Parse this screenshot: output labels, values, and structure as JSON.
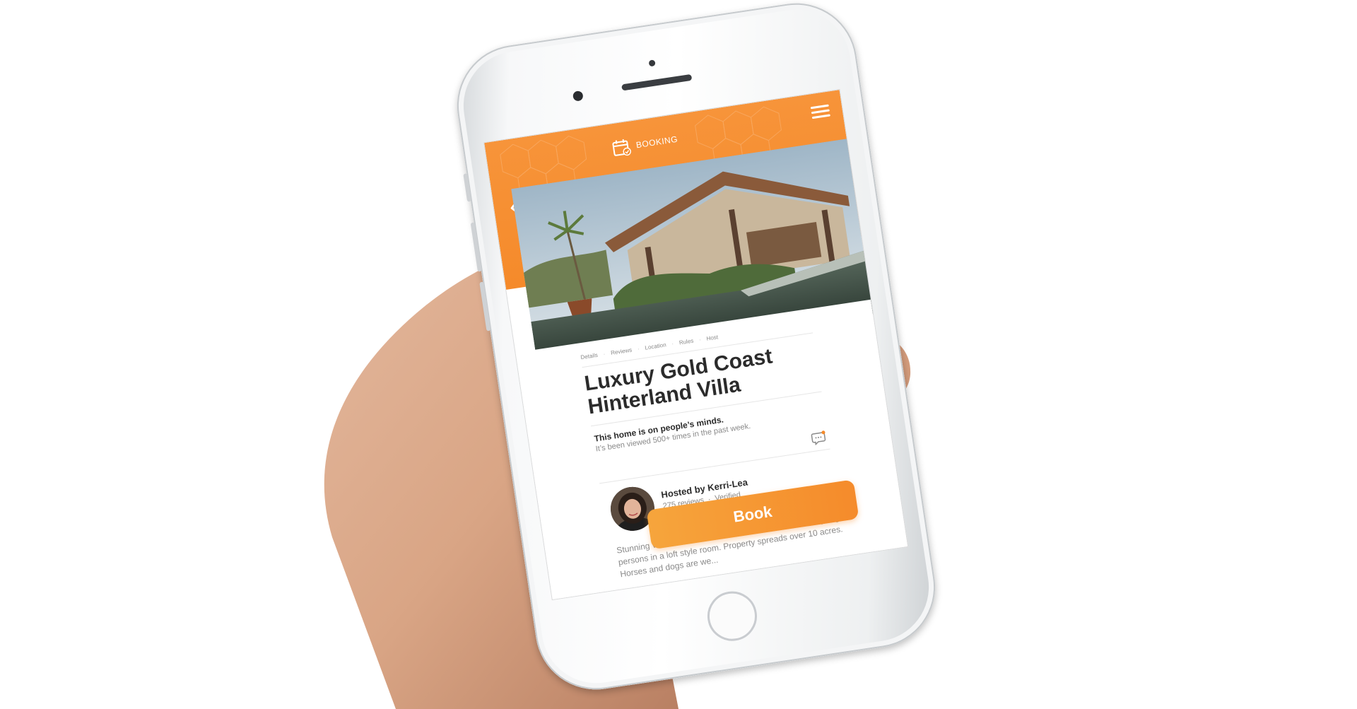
{
  "header": {
    "brand_label": "BOOKING",
    "icons": {
      "menu": "hamburger-menu-icon",
      "back": "chevron-left-icon",
      "logo": "calendar-check-icon"
    },
    "color": "#F58A2A"
  },
  "listing": {
    "section_tabs": [
      "Details",
      "Reviews",
      "Location",
      "Rules",
      "Host"
    ],
    "title": "Luxury Gold Coast Hinterland Villa",
    "popularity_heading": "This home is on people’s minds.",
    "popularity_sub": "It’s been viewed 500+ times in the past week.",
    "host": {
      "name": "Hosted by Kerri-Lea",
      "reviews": "275 reviews",
      "separator": "·",
      "status": "Verified"
    },
    "description": "Stunning views over the hinterland. Luxurious villa sleep-ing 10 persons in a loft style room. Property spreads over 10 acres. Horses and dogs are we..."
  },
  "actions": {
    "book_label": "Book"
  },
  "colors": {
    "accent": "#F58A2A",
    "accent_light": "#F6A53C",
    "title_text": "#2B2B2B",
    "muted_text": "#8A8A8A"
  }
}
